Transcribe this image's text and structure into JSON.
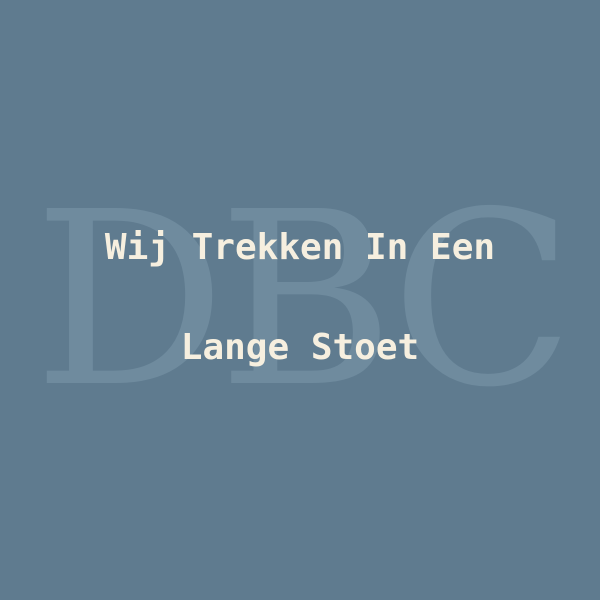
{
  "watermark": {
    "text": "DBC",
    "color": "#6f8b9e"
  },
  "title": {
    "line1": "Wij Trekken In Een",
    "line2": "Lange Stoet",
    "color": "#f6efdf"
  },
  "background_color": "#5f7b8f"
}
